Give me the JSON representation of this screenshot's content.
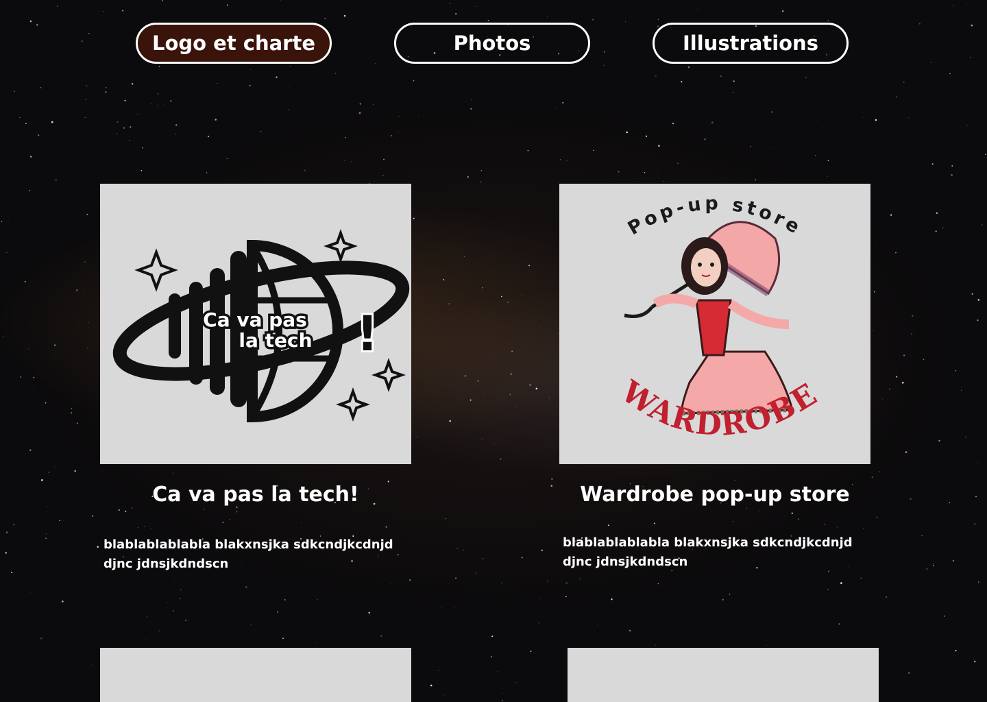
{
  "nav": {
    "tabs": [
      {
        "label": "Logo et charte",
        "active": true
      },
      {
        "label": "Photos",
        "active": false
      },
      {
        "label": "Illustrations",
        "active": false
      }
    ]
  },
  "projects": [
    {
      "title": "Ca va pas la tech!",
      "description": "blablablablabla blakxnsjka sdkcndjkcdnjd djnc jdnsjkdndscn",
      "logo_text": [
        "Ca va pas",
        "la tech",
        "!"
      ]
    },
    {
      "title": "Wardrobe pop-up store",
      "description": "blablablablabla blakxnsjka sdkcndjkcdnjd djnc jdnsjkdndscn",
      "logo_top": "Pop-up store",
      "logo_bottom": "WARDROBE"
    }
  ],
  "colors": {
    "active_tab": "#3a130a",
    "card_bg": "#d9d9d9",
    "wardrobe_red": "#c0202f",
    "dress_pink": "#f4a9a8"
  }
}
